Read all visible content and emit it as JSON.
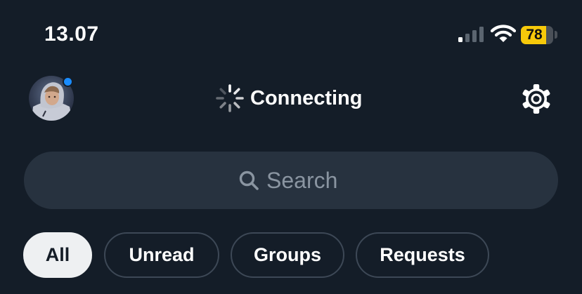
{
  "status_bar": {
    "time": "13.07",
    "signal_bars_active": 1,
    "signal_bars_total": 4,
    "battery_percent": 78,
    "battery_label": "78",
    "battery_color": "#f7c90a",
    "icons": [
      "signal-icon",
      "wifi-icon",
      "battery-icon"
    ]
  },
  "header": {
    "title": "Connecting",
    "status_indicator_color": "#1a8cff",
    "icons": [
      "spinner-icon",
      "gear-icon"
    ]
  },
  "search": {
    "placeholder": "Search",
    "value": ""
  },
  "filters": {
    "selected": "All",
    "items": [
      {
        "label": "All"
      },
      {
        "label": "Unread"
      },
      {
        "label": "Groups"
      },
      {
        "label": "Requests"
      }
    ]
  },
  "colors": {
    "background": "#141d28",
    "search_background": "#27323f",
    "chip_border": "#3d4856",
    "chip_active_background": "#eef0f2"
  }
}
